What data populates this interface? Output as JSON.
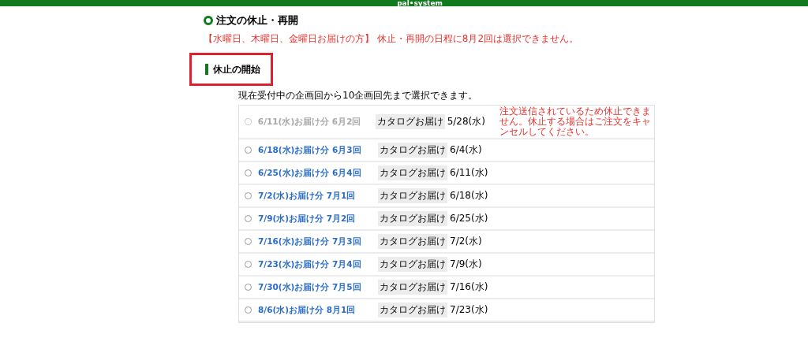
{
  "header": {
    "logo": "pal•system"
  },
  "page_title": "注文の休止・再開",
  "notice": "【水曜日、木曜日、金曜日お届けの方】 休止・再開の日程に8月2回は選択できません。",
  "section": {
    "title": "休止の開始",
    "highlighted": true
  },
  "intro": "現在受付中の企画回から10企画回先まで選択できます。",
  "options": [
    {
      "label": "6/11(水)お届け分 6月2回",
      "disabled": true,
      "selected": false,
      "tag": "カタログお届け",
      "date": "5/28(水)",
      "note": "注文送信されているため休止できません。休止する場合はご注文をキャンセルしてください。"
    },
    {
      "label": "6/18(水)お届け分 6月3回",
      "disabled": false,
      "selected": false,
      "tag": "カタログお届け",
      "date": "6/4(水)"
    },
    {
      "label": "6/25(水)お届け分 6月4回",
      "disabled": false,
      "selected": false,
      "tag": "カタログお届け",
      "date": "6/11(水)"
    },
    {
      "label": "7/2(水)お届け分 7月1回",
      "disabled": false,
      "selected": false,
      "tag": "カタログお届け",
      "date": "6/18(水)"
    },
    {
      "label": "7/9(水)お届け分 7月2回",
      "disabled": false,
      "selected": false,
      "tag": "カタログお届け",
      "date": "6/25(水)"
    },
    {
      "label": "7/16(水)お届け分 7月3回",
      "disabled": false,
      "selected": false,
      "tag": "カタログお届け",
      "date": "7/2(水)"
    },
    {
      "label": "7/23(水)お届け分 7月4回",
      "disabled": false,
      "selected": false,
      "tag": "カタログお届け",
      "date": "7/9(水)"
    },
    {
      "label": "7/30(水)お届け分 7月5回",
      "disabled": false,
      "selected": false,
      "tag": "カタログお届け",
      "date": "7/16(水)"
    },
    {
      "label": "8/6(水)お届け分 8月1回",
      "disabled": false,
      "selected": false,
      "tag": "カタログお届け",
      "date": "7/23(水)"
    }
  ]
}
